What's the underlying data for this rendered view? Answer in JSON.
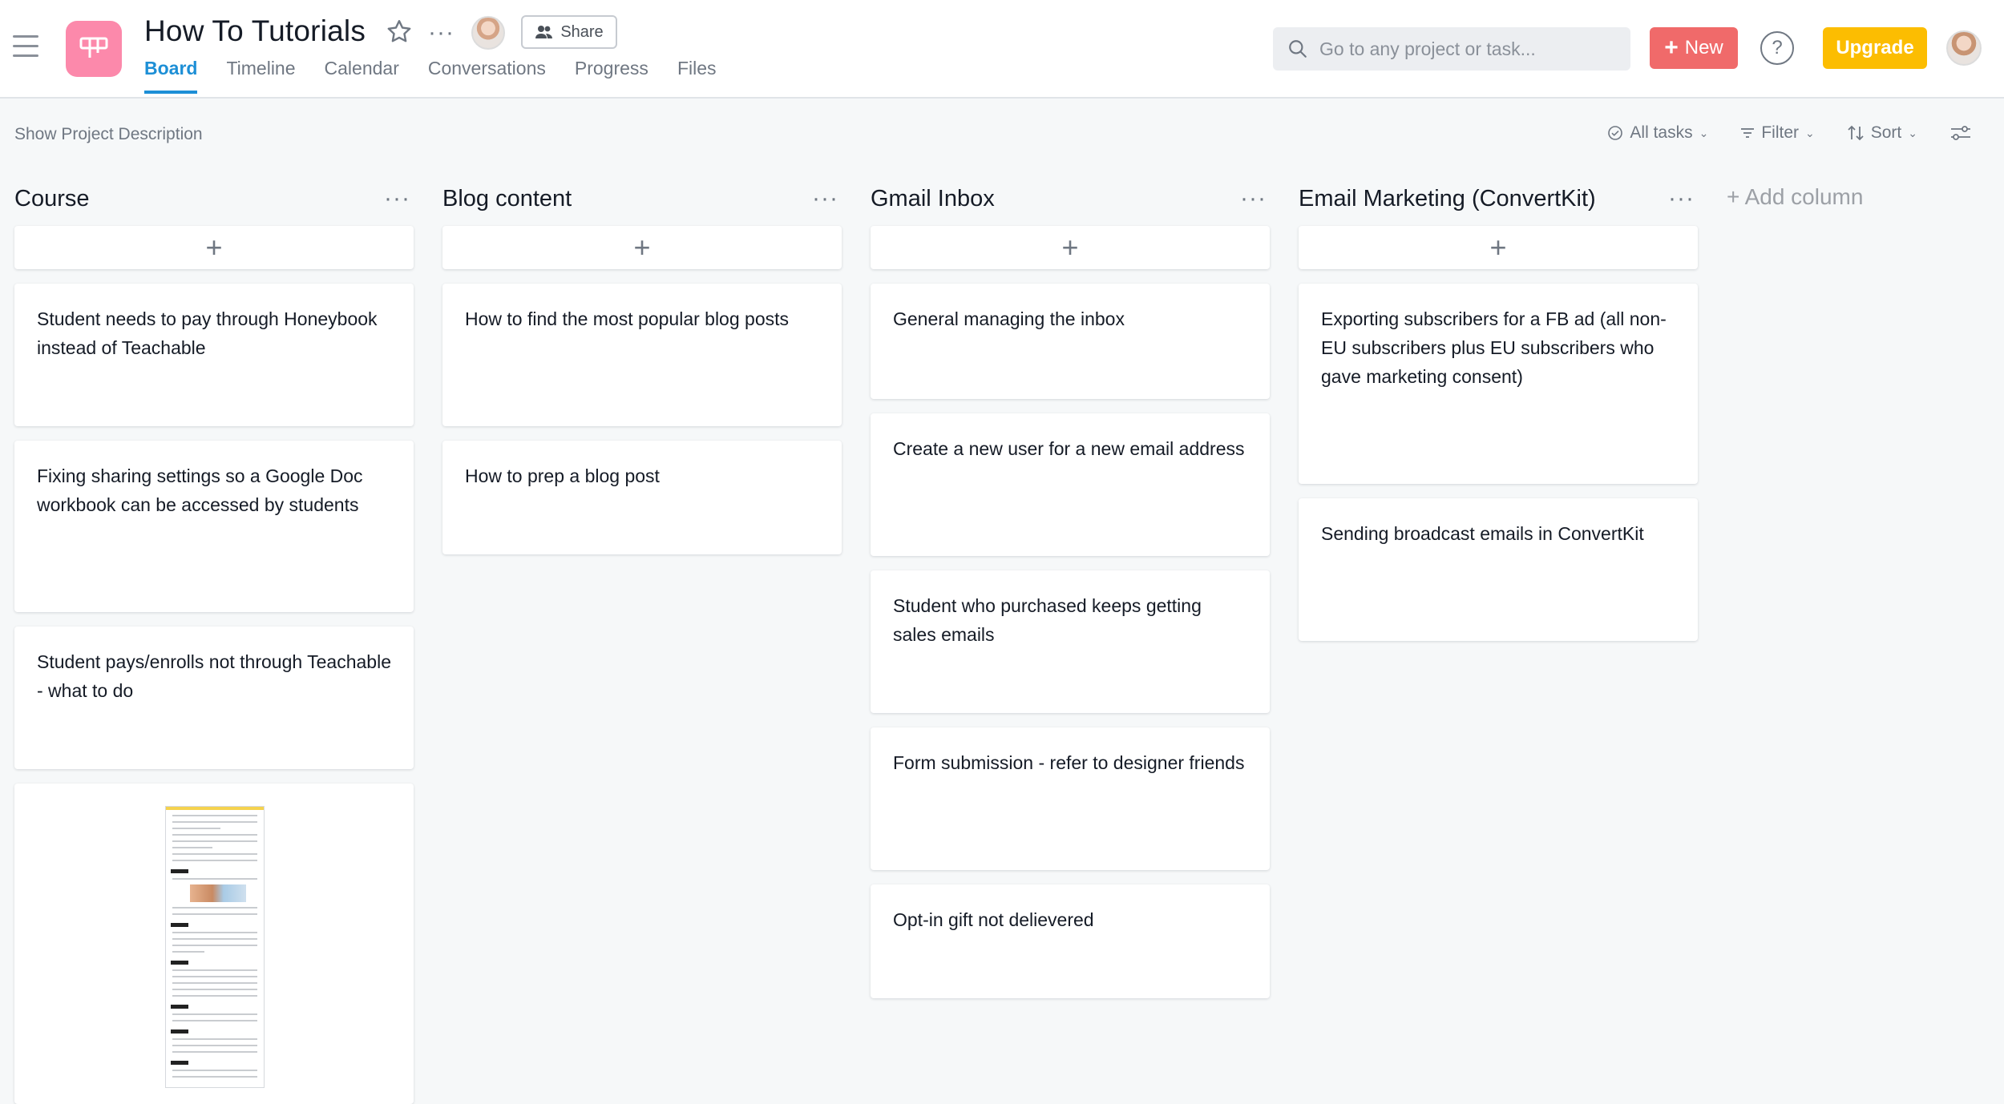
{
  "project": {
    "title": "How To Tutorials",
    "icon_color": "#fc89ab"
  },
  "header": {
    "share_label": "Share",
    "tabs": [
      {
        "label": "Board",
        "active": true
      },
      {
        "label": "Timeline",
        "active": false
      },
      {
        "label": "Calendar",
        "active": false
      },
      {
        "label": "Conversations",
        "active": false
      },
      {
        "label": "Progress",
        "active": false
      },
      {
        "label": "Files",
        "active": false
      }
    ],
    "search_placeholder": "Go to any project or task...",
    "new_label": "New",
    "help_label": "?",
    "upgrade_label": "Upgrade"
  },
  "subbar": {
    "show_description": "Show Project Description",
    "all_tasks": "All tasks",
    "filter": "Filter",
    "sort": "Sort"
  },
  "board": {
    "add_column": "+ Add column",
    "columns": [
      {
        "title": "Course",
        "cards": [
          "Student needs to pay through Honeybook instead of Teachable",
          "Fixing sharing settings so a Google Doc workbook can be accessed by students",
          "Student pays/enrolls not through Teachable - what to do"
        ]
      },
      {
        "title": "Blog content",
        "cards": [
          "How to find the most popular blog posts",
          "How to prep a blog post"
        ]
      },
      {
        "title": "Gmail Inbox",
        "cards": [
          "General managing the inbox",
          "Create a new user for a new email address",
          "Student who purchased keeps getting sales emails",
          "Form submission - refer to designer friends",
          "Opt-in gift not delievered"
        ]
      },
      {
        "title": "Email Marketing (ConvertKit)",
        "cards": [
          "Exporting subscribers for a FB ad (all non-EU subscribers plus EU subscribers who gave marketing consent)",
          "Sending broadcast emails in ConvertKit"
        ]
      }
    ]
  },
  "colors": {
    "accent": "#1d8fd6",
    "new_button": "#f06a6a",
    "upgrade_button": "#fcbd01"
  }
}
